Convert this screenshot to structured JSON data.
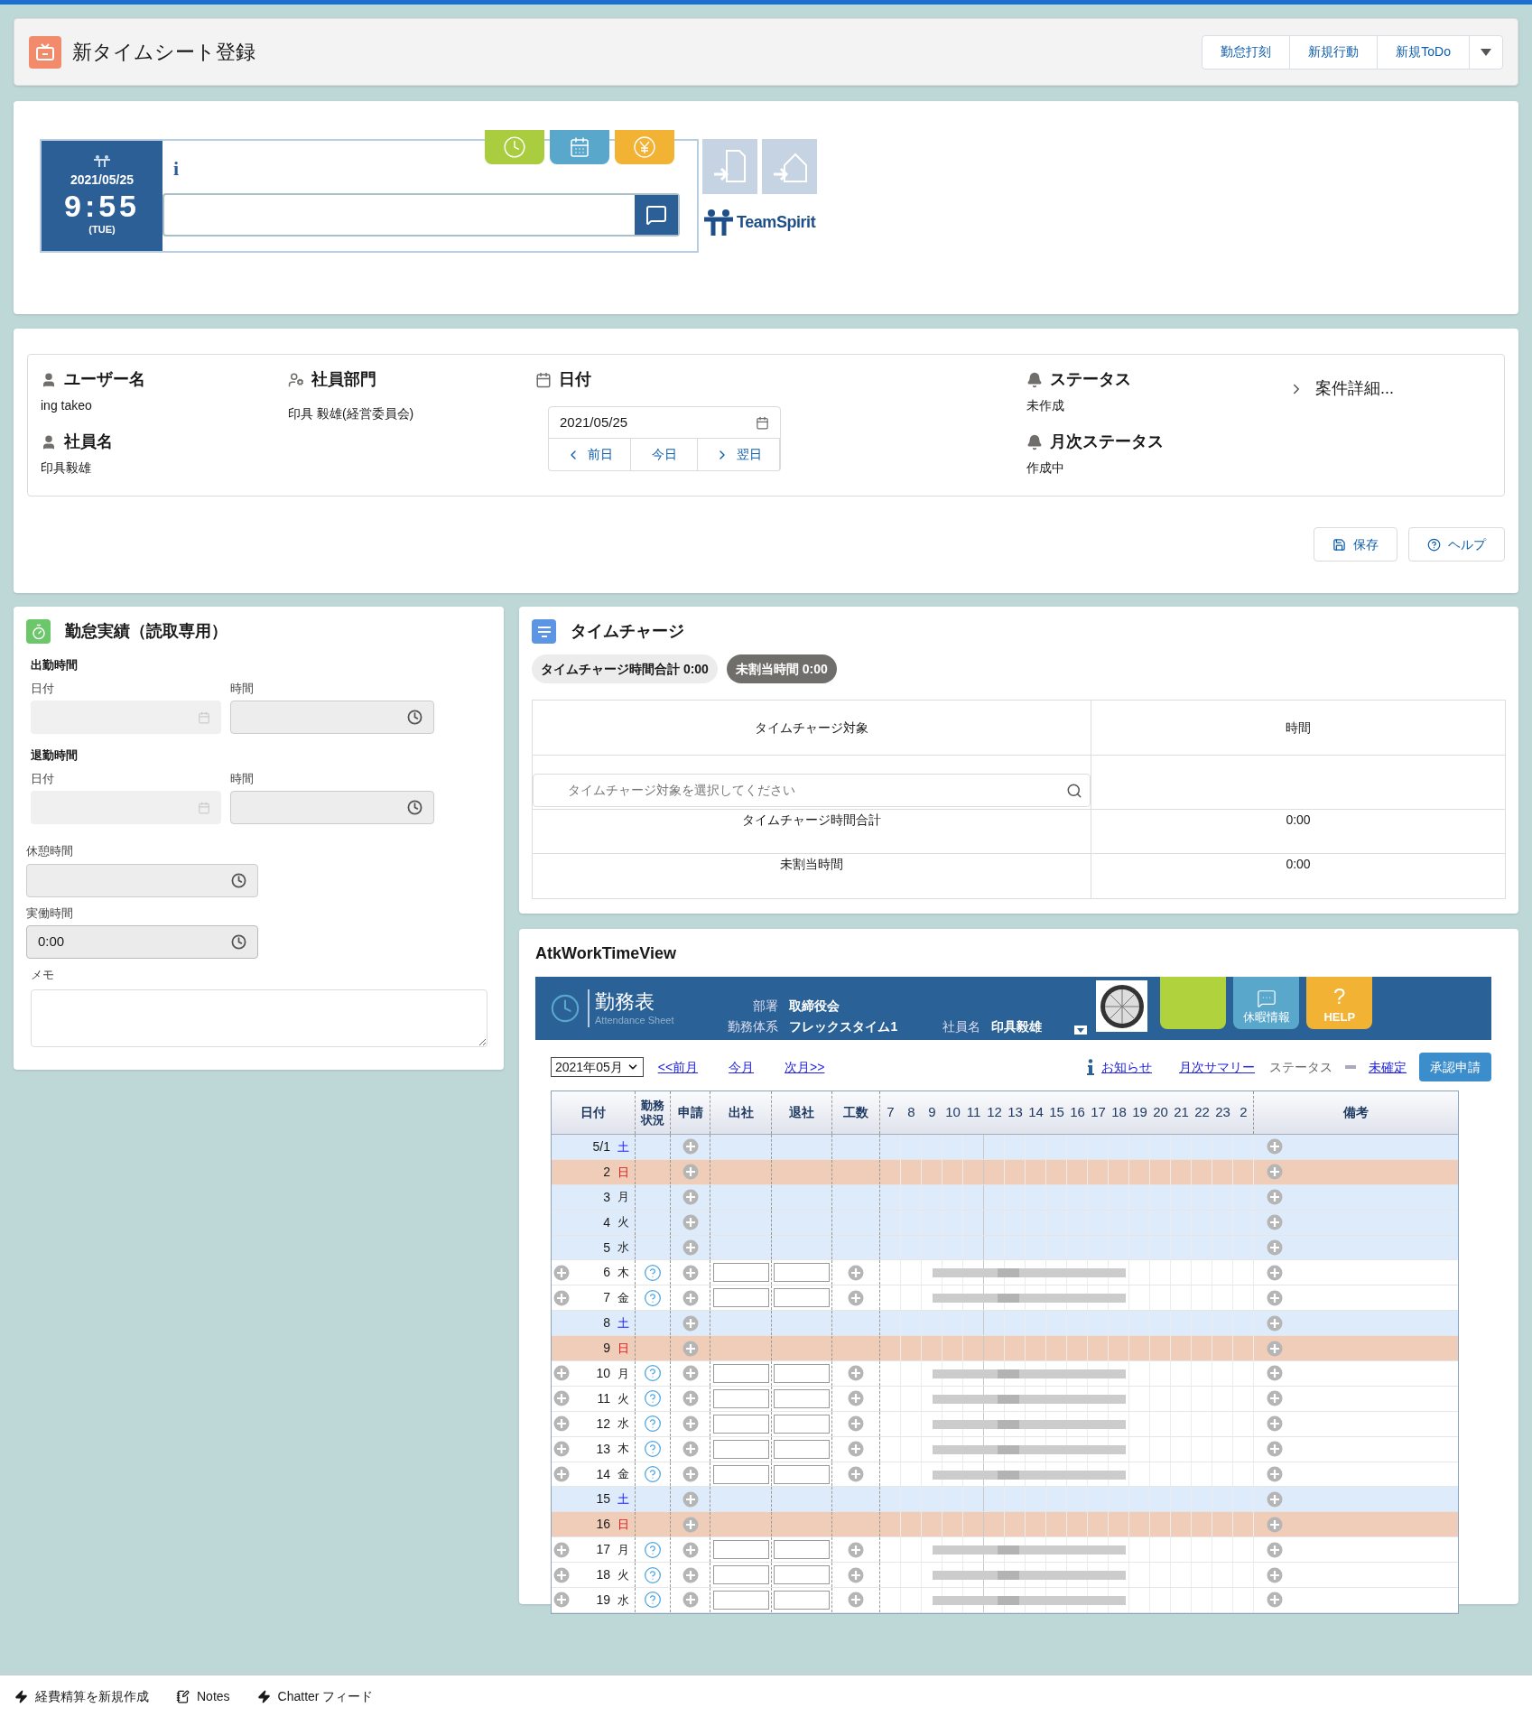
{
  "header": {
    "title": "新タイムシート登録",
    "buttons": [
      "勤怠打刻",
      "新規行動",
      "新規ToDo"
    ]
  },
  "clock": {
    "date": "2021/05/25",
    "time": "9:55",
    "weekday": "(TUE)",
    "info": "i",
    "logo": "TeamSpirit"
  },
  "info": {
    "user_name": {
      "label": "ユーザー名",
      "value": "ing takeo"
    },
    "employee_name": {
      "label": "社員名",
      "value": "印具毅雄"
    },
    "department": {
      "label": "社員部門",
      "value": "印具 毅雄(経営委員会)"
    },
    "date": {
      "label": "日付",
      "value": "2021/05/25",
      "buttons": [
        "前日",
        "今日",
        "翌日"
      ]
    },
    "status": {
      "label": "ステータス",
      "value": "未作成"
    },
    "monthly_status": {
      "label": "月次ステータス",
      "value": "作成中"
    },
    "details": "案件詳細...",
    "actions": [
      "保存",
      "ヘルプ"
    ]
  },
  "attendance_panel": {
    "title": "勤怠実績（読取専用）",
    "sections": [
      {
        "heading": "出勤時間",
        "date_label": "日付",
        "time_label": "時間"
      },
      {
        "heading": "退勤時間",
        "date_label": "日付",
        "time_label": "時間"
      }
    ],
    "break": {
      "label": "休憩時間"
    },
    "actual": {
      "label": "実働時間",
      "value": "0:00"
    },
    "memo": {
      "label": "メモ"
    }
  },
  "time_charge": {
    "title": "タイムチャージ",
    "pills": [
      {
        "text": "タイムチャージ時間合計 0:00",
        "kind": "light"
      },
      {
        "text": "未割当時間 0:00",
        "kind": "dark"
      }
    ],
    "columns": [
      "タイムチャージ対象",
      "時間"
    ],
    "search_placeholder": "タイムチャージ対象を選択してください",
    "rows": [
      {
        "label": "タイムチャージ時間合計",
        "value": "0:00"
      },
      {
        "label": "未割当時間",
        "value": "0:00"
      }
    ]
  },
  "work_view": {
    "title": "AtkWorkTimeView",
    "sheet": {
      "title": "勤務表",
      "subtitle": "Attendance Sheet",
      "fields": [
        {
          "label": "部署",
          "value": "取締役会"
        },
        {
          "label": "勤務体系",
          "value": "フレックスタイム1"
        },
        {
          "label": "社員名",
          "value": "印具毅雄"
        }
      ],
      "vacation": "休暇情報",
      "help_mark": "?",
      "help": "HELP"
    },
    "toolbar": {
      "month": "2021年05月",
      "links": [
        "<<前月",
        "今月",
        "次月>>"
      ],
      "notice": "お知らせ",
      "summary": "月次サマリー",
      "status_label": "ステータス",
      "status_value": "未確定",
      "submit": "承認申請"
    },
    "columns": [
      "日付",
      "勤務状況",
      "申請",
      "出社",
      "退社",
      "工数"
    ],
    "hours": [
      "7",
      "8",
      "9",
      "10",
      "11",
      "12",
      "13",
      "14",
      "15",
      "16",
      "17",
      "18",
      "19",
      "20",
      "21",
      "22",
      "23",
      "2"
    ],
    "remarks": "備考",
    "rows": [
      {
        "day": "5/1",
        "weekday": "土",
        "kind": "saturday"
      },
      {
        "day": "2",
        "weekday": "日",
        "kind": "sunday"
      },
      {
        "day": "3",
        "weekday": "月",
        "kind": "holiday"
      },
      {
        "day": "4",
        "weekday": "火",
        "kind": "holiday"
      },
      {
        "day": "5",
        "weekday": "水",
        "kind": "holiday"
      },
      {
        "day": "6",
        "weekday": "木",
        "kind": "work"
      },
      {
        "day": "7",
        "weekday": "金",
        "kind": "work"
      },
      {
        "day": "8",
        "weekday": "土",
        "kind": "saturday"
      },
      {
        "day": "9",
        "weekday": "日",
        "kind": "sunday"
      },
      {
        "day": "10",
        "weekday": "月",
        "kind": "work"
      },
      {
        "day": "11",
        "weekday": "火",
        "kind": "work"
      },
      {
        "day": "12",
        "weekday": "水",
        "kind": "work"
      },
      {
        "day": "13",
        "weekday": "木",
        "kind": "work"
      },
      {
        "day": "14",
        "weekday": "金",
        "kind": "work"
      },
      {
        "day": "15",
        "weekday": "土",
        "kind": "saturday"
      },
      {
        "day": "16",
        "weekday": "日",
        "kind": "sunday"
      },
      {
        "day": "17",
        "weekday": "月",
        "kind": "work"
      },
      {
        "day": "18",
        "weekday": "火",
        "kind": "work"
      },
      {
        "day": "19",
        "weekday": "水",
        "kind": "work"
      }
    ]
  },
  "footer": [
    {
      "text": "経費精算を新規作成",
      "kind": "action"
    },
    {
      "text": "Notes",
      "kind": "notes"
    },
    {
      "text": "Chatter フィード",
      "kind": "action"
    }
  ]
}
